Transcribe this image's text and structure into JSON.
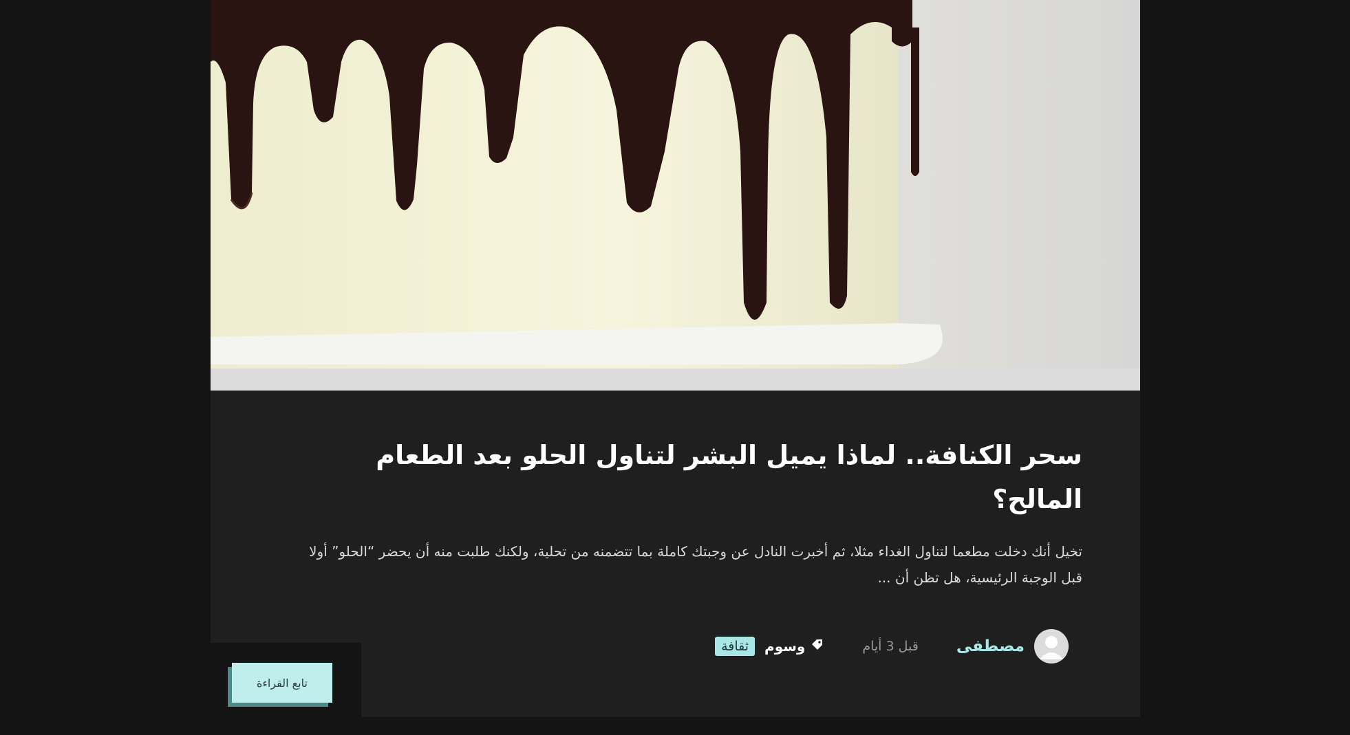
{
  "article": {
    "title": "سحر الكنافة.. لماذا يميل البشر لتناول الحلو بعد الطعام المالح؟",
    "excerpt": "تخيل أنك دخلت مطعما لتناول الغداء مثلا، ثم أخبرت النادل عن وجبتك كاملة بما تتضمنه من تحلية، ولكنك طلبت منه أن يحضر “الحلو” أولا قبل الوجبة الرئيسية، هل تظن أن ...",
    "author": "مصطفى",
    "date": "قبل 3 أيام",
    "tags_label": "وسوم",
    "tag": "ثقافة",
    "read_more": "تابع القراءة"
  },
  "icons": {
    "avatar": "user-avatar-icon",
    "tags": "tag-icon"
  },
  "colors": {
    "accent": "#a9e7e6",
    "card_bg": "#1f1f1f",
    "page_bg": "#141414"
  }
}
